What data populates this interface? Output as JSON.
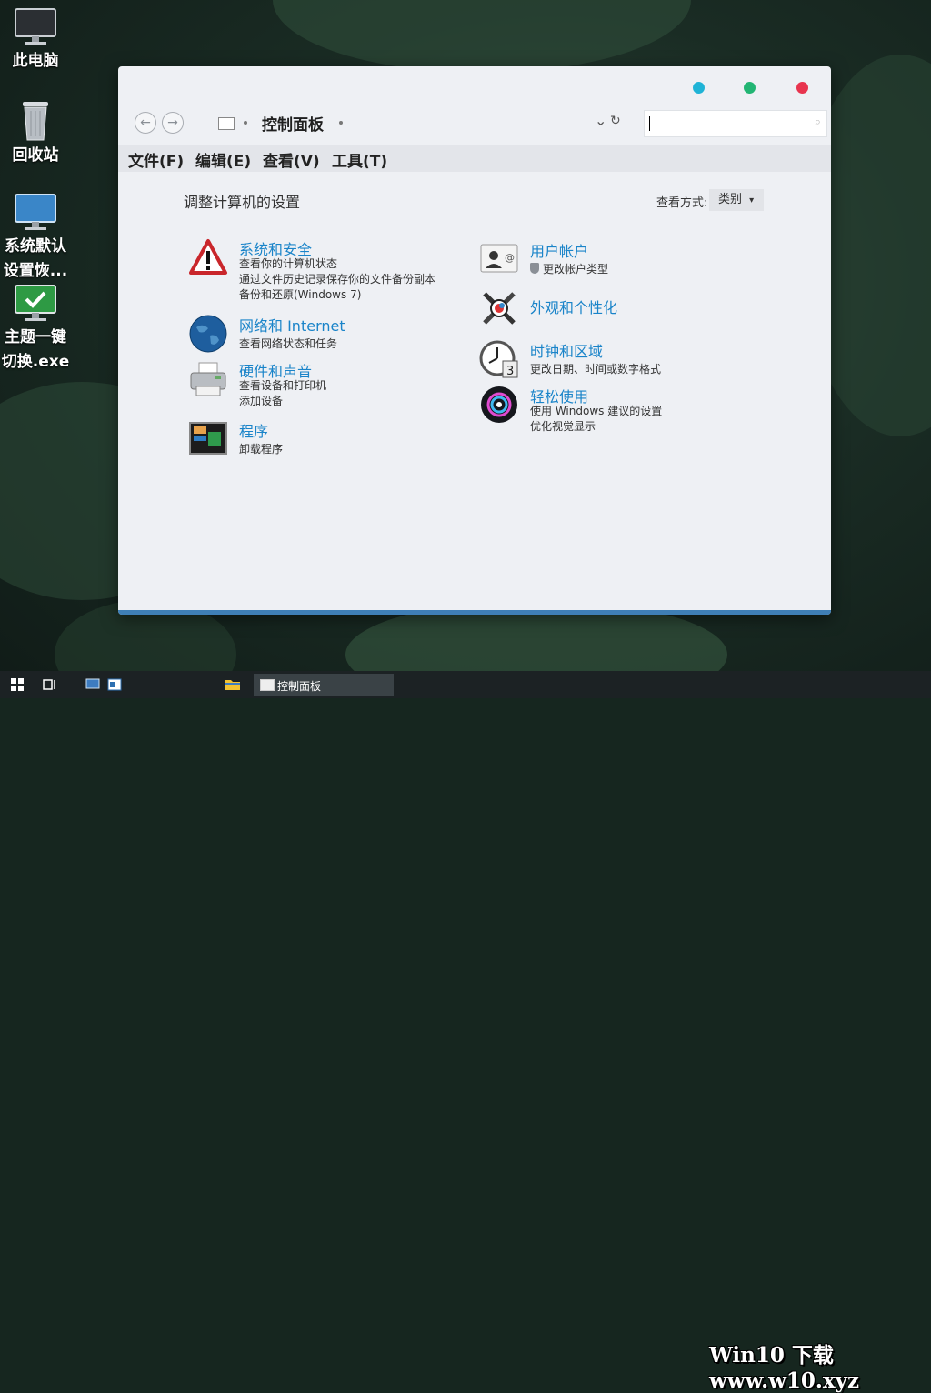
{
  "desktop": {
    "icons": [
      {
        "label": "此电脑"
      },
      {
        "label": "回收站"
      },
      {
        "label_line1": "系统默认",
        "label_line2": "设置恢..."
      },
      {
        "label_line1": "主题一键",
        "label_line2": "切换.exe"
      }
    ]
  },
  "window": {
    "breadcrumb": "控制面板",
    "back_glyph": "←",
    "forward_glyph": "→",
    "refresh_glyph": "↻",
    "dropdown_glyph": "⌄",
    "search_glyph": "⌕",
    "search_value": "",
    "traffic_lights": {
      "minimize": "#1fb3d6",
      "maximize": "#22b573",
      "close": "#e8344e"
    },
    "menu": [
      "文件(F)",
      "编辑(E)",
      "查看(V)",
      "工具(T)"
    ],
    "heading": "调整计算机的设置",
    "view_by_label": "查看方式:",
    "view_by_value": "类别",
    "view_by_arrow": "▾",
    "categories": [
      {
        "title": "系统和安全",
        "icon": "warning-shield-icon",
        "links": [
          "查看你的计算机状态",
          "通过文件历史记录保存你的文件备份副本",
          "备份和还原(Windows 7)"
        ]
      },
      {
        "title": "网络和 Internet",
        "icon": "globe-icon",
        "links": [
          "查看网络状态和任务"
        ]
      },
      {
        "title": "硬件和声音",
        "icon": "printer-icon",
        "links": [
          "查看设备和打印机",
          "添加设备"
        ]
      },
      {
        "title": "程序",
        "icon": "programs-icon",
        "links": [
          "卸载程序"
        ]
      },
      {
        "title": "用户帐户",
        "icon": "user-card-icon",
        "links": [
          "更改帐户类型"
        ]
      },
      {
        "title": "外观和个性化",
        "icon": "appearance-tools-icon",
        "links": []
      },
      {
        "title": "时钟和区域",
        "icon": "clock-icon",
        "links": [
          "更改日期、时间或数字格式"
        ]
      },
      {
        "title": "轻松使用",
        "icon": "accessibility-orb-icon",
        "links": [
          "使用 Windows 建议的设置",
          "优化视觉显示"
        ]
      }
    ]
  },
  "taskbar": {
    "active_task": "控制面板",
    "watermark": "Win10 下载 www.w10.xyz"
  },
  "colors": {
    "accent": "#1a84c9",
    "window_bg": "#eef0f4",
    "taskbar": "#1c2224"
  }
}
